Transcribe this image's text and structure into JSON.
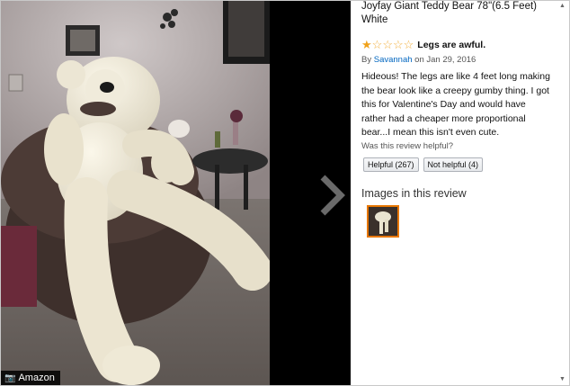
{
  "watermark": {
    "label": "Amazon",
    "icon": "camera-icon"
  },
  "viewer": {
    "next_icon": "chevron-right-icon"
  },
  "product": {
    "title": "Joyfay Giant Teddy Bear 78\"(6.5 Feet) White"
  },
  "review": {
    "rating": 1,
    "max_rating": 5,
    "title": "Legs are awful.",
    "by_prefix": "By",
    "author": "Savannah",
    "date": "on Jan 29, 2016",
    "body": "Hideous! The legs are like 4 feet long making the bear look like a creepy gumby thing. I got this for Valentine's Day and would have rather had a cheaper more proportional bear...I mean this isn't even cute.",
    "helpful_question": "Was this review helpful?",
    "helpful_button": "Helpful (267)",
    "not_helpful_button": "Not helpful (4)"
  },
  "images_section": {
    "heading": "Images in this review"
  },
  "colors": {
    "star": "#f0a21b",
    "link": "#0066c0",
    "thumb_border": "#e77600"
  },
  "scrollbar": {
    "up_icon": "triangle-up-icon",
    "down_icon": "triangle-down-icon"
  }
}
